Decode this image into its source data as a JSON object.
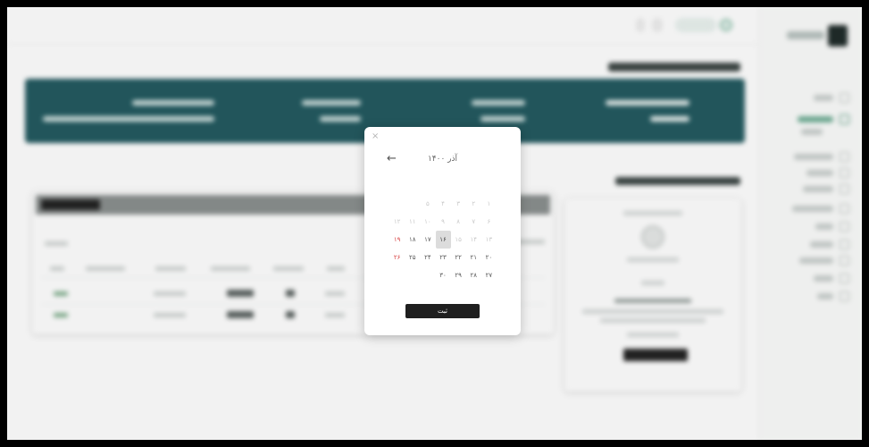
{
  "datepicker": {
    "close_icon": "×",
    "back_arrow": "←",
    "month_label": "آذر ۱۴۰۰",
    "submit_label": "ثبت",
    "rows": [
      [
        {
          "t": "",
          "k": "faint"
        },
        {
          "t": "",
          "k": "faint"
        },
        {
          "t": "",
          "k": "faint"
        },
        {
          "t": "",
          "k": "faint"
        },
        {
          "t": "",
          "k": "faint"
        },
        {
          "t": "",
          "k": "faint"
        },
        {
          "t": "",
          "k": "faint"
        }
      ],
      [
        {
          "t": "۱",
          "k": "faint"
        },
        {
          "t": "۲",
          "k": "faint"
        },
        {
          "t": "۳",
          "k": "faint"
        },
        {
          "t": "۴",
          "k": "faint"
        },
        {
          "t": "۵",
          "k": "faint"
        },
        {
          "t": "",
          "k": ""
        },
        {
          "t": "",
          "k": ""
        }
      ],
      [
        {
          "t": "۶",
          "k": "faint"
        },
        {
          "t": "۷",
          "k": "faint"
        },
        {
          "t": "۸",
          "k": "faint"
        },
        {
          "t": "۹",
          "k": "faint"
        },
        {
          "t": "۱۰",
          "k": "faint"
        },
        {
          "t": "۱۱",
          "k": "faint"
        },
        {
          "t": "۱۲",
          "k": "faint"
        }
      ],
      [
        {
          "t": "۱۳",
          "k": "faint"
        },
        {
          "t": "۱۴",
          "k": "faint"
        },
        {
          "t": "۱۵",
          "k": "faint"
        },
        {
          "t": "۱۶",
          "k": "sel"
        },
        {
          "t": "۱۷",
          "k": ""
        },
        {
          "t": "۱۸",
          "k": ""
        },
        {
          "t": "۱۹",
          "k": "red"
        }
      ],
      [
        {
          "t": "۲۰",
          "k": ""
        },
        {
          "t": "۲۱",
          "k": ""
        },
        {
          "t": "۲۲",
          "k": ""
        },
        {
          "t": "۲۳",
          "k": ""
        },
        {
          "t": "۲۴",
          "k": ""
        },
        {
          "t": "۲۵",
          "k": ""
        },
        {
          "t": "۲۶",
          "k": "red"
        }
      ],
      [
        {
          "t": "۲۷",
          "k": ""
        },
        {
          "t": "۲۸",
          "k": ""
        },
        {
          "t": "۲۹",
          "k": ""
        },
        {
          "t": "۳۰",
          "k": ""
        },
        {
          "t": "",
          "k": ""
        },
        {
          "t": "",
          "k": ""
        },
        {
          "t": "",
          "k": ""
        }
      ]
    ]
  },
  "colors": {
    "banner": "#22595f",
    "accent_green": "#3e8b6f",
    "holiday_red": "#d84545",
    "selected_bg": "#dcdcdc"
  }
}
